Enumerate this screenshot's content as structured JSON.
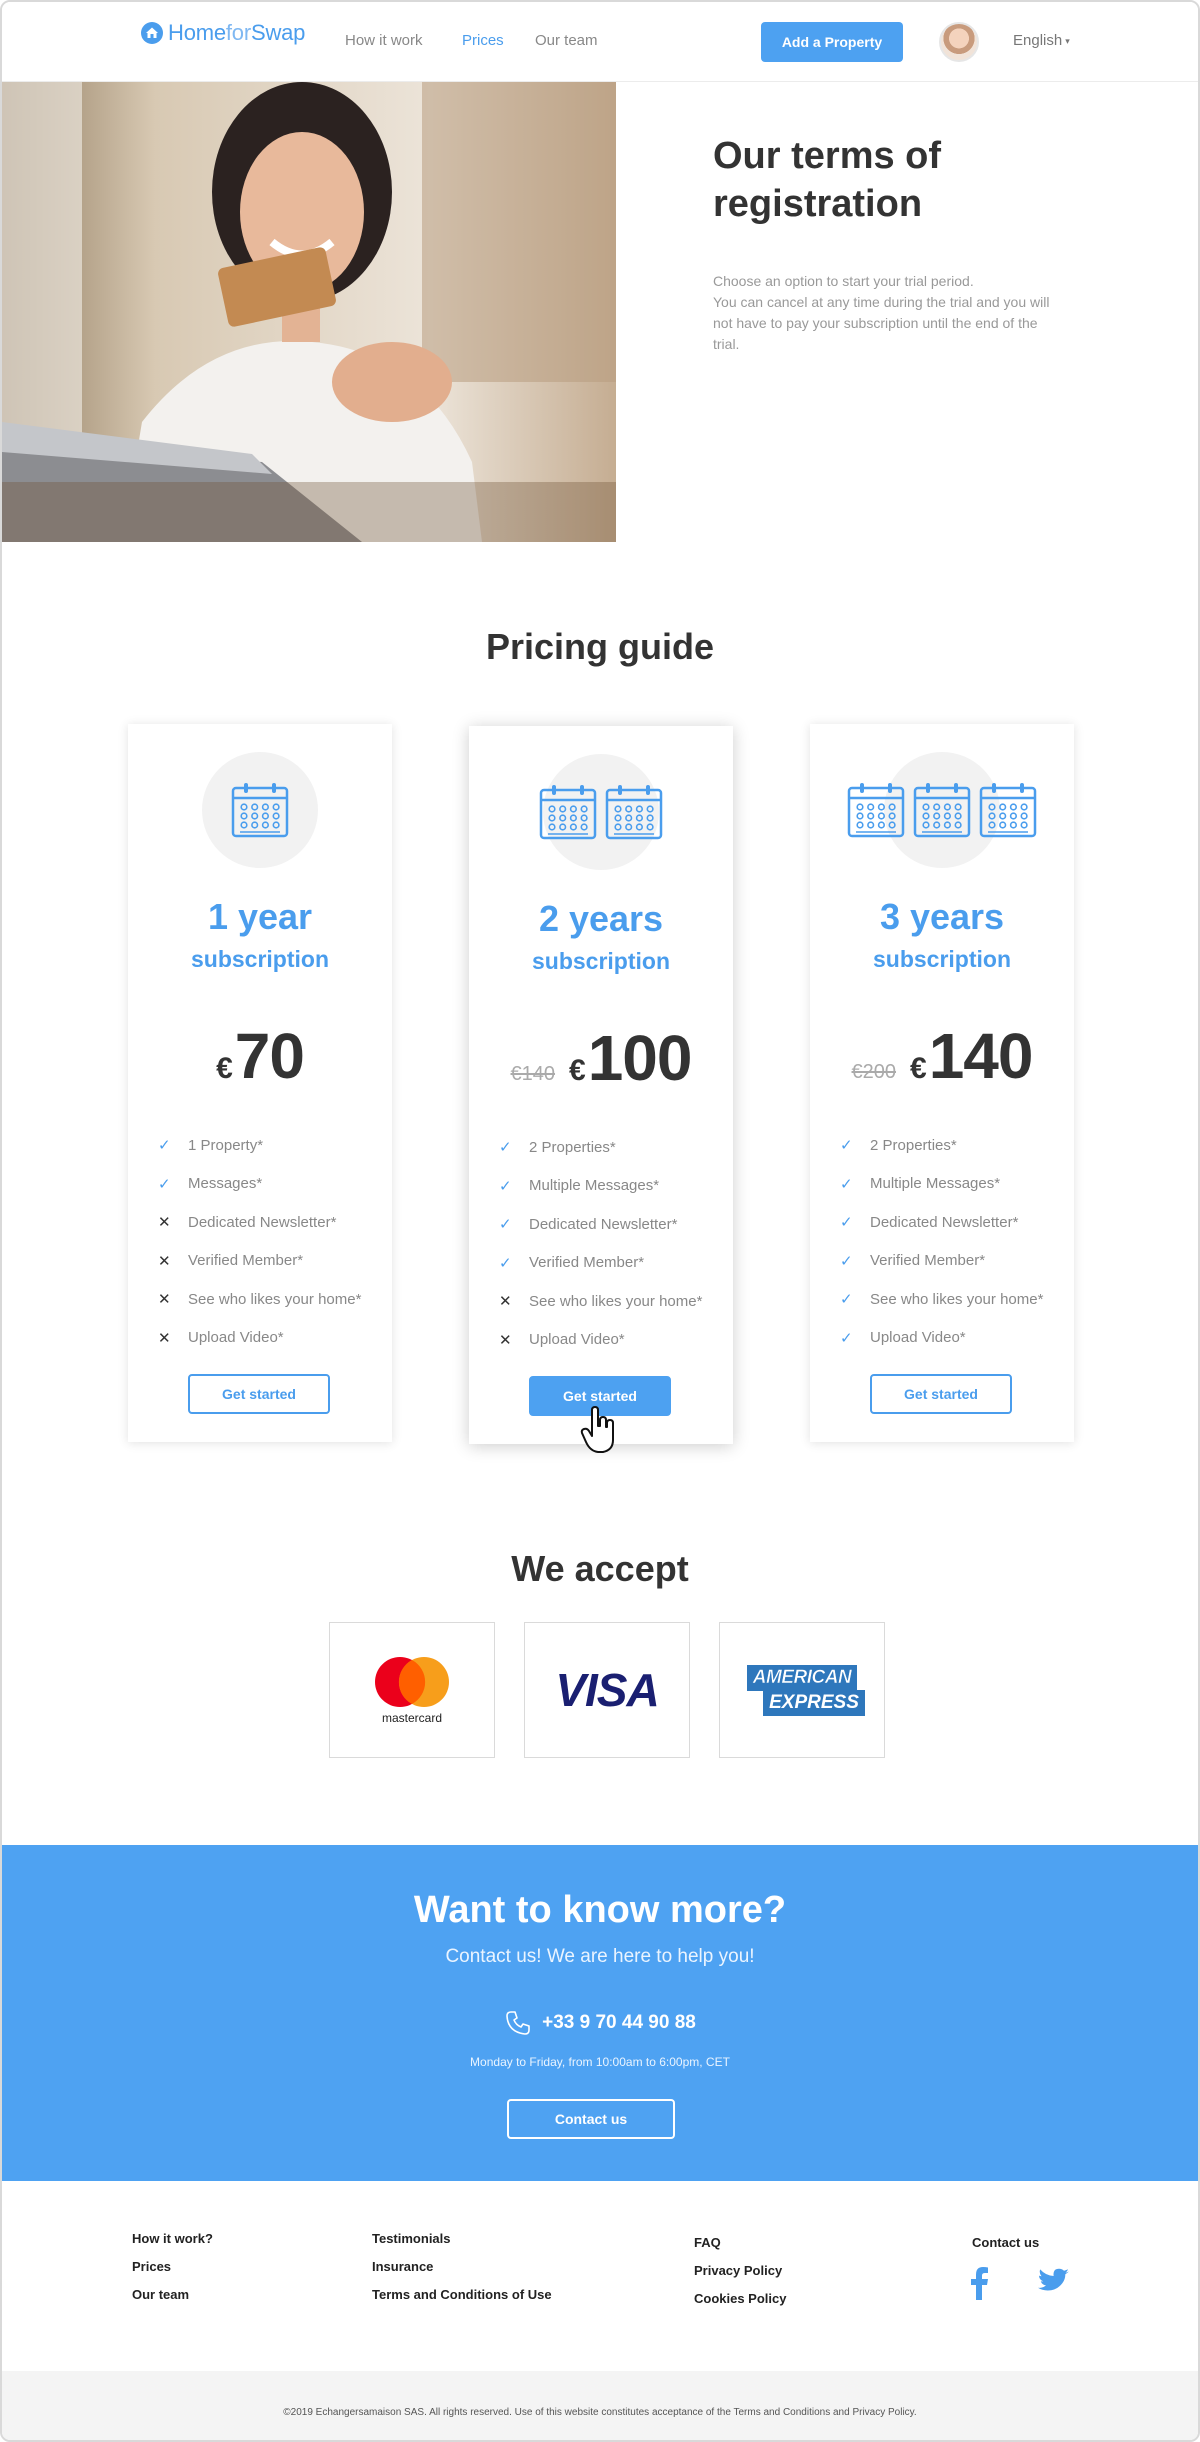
{
  "header": {
    "logo": {
      "home": "Home",
      "for": "for",
      "swap": "Swap"
    },
    "nav": [
      {
        "label": "How it work",
        "active": false
      },
      {
        "label": "Prices",
        "active": true
      },
      {
        "label": "Our team",
        "active": false
      }
    ],
    "add_property_label": "Add a Property",
    "language": "English"
  },
  "hero": {
    "title": "Our terms of registration",
    "description_line1": "Choose an option to start your trial period.",
    "description_line2": "You can cancel at any time during the trial and you will not have to pay your subscription until the end of the trial."
  },
  "pricing": {
    "title": "Pricing guide",
    "plans": [
      {
        "number": "1 year",
        "subtitle": "subscription",
        "old_price": "",
        "currency": "€",
        "price": "70",
        "calendars": 1,
        "features": [
          {
            "label": "1 Property*",
            "included": true
          },
          {
            "label": "Messages*",
            "included": true
          },
          {
            "label": "Dedicated Newsletter*",
            "included": false
          },
          {
            "label": "Verified Member*",
            "included": false
          },
          {
            "label": "See who likes your home*",
            "included": false
          },
          {
            "label": "Upload Video*",
            "included": false
          }
        ],
        "button_label": "Get started"
      },
      {
        "number": "2 years",
        "subtitle": "subscription",
        "old_price": "€140",
        "currency": "€",
        "price": "100",
        "calendars": 2,
        "features": [
          {
            "label": "2 Properties*",
            "included": true
          },
          {
            "label": "Multiple Messages*",
            "included": true
          },
          {
            "label": "Dedicated Newsletter*",
            "included": true
          },
          {
            "label": "Verified Member*",
            "included": true
          },
          {
            "label": "See who likes your home*",
            "included": false
          },
          {
            "label": "Upload Video*",
            "included": false
          }
        ],
        "button_label": "Get started"
      },
      {
        "number": "3 years",
        "subtitle": "subscription",
        "old_price": "€200",
        "currency": "€",
        "price": "140",
        "calendars": 3,
        "features": [
          {
            "label": "2 Properties*",
            "included": true
          },
          {
            "label": "Multiple Messages*",
            "included": true
          },
          {
            "label": "Dedicated Newsletter*",
            "included": true
          },
          {
            "label": "Verified Member*",
            "included": true
          },
          {
            "label": "See who likes your home*",
            "included": true
          },
          {
            "label": "Upload Video*",
            "included": true
          }
        ],
        "button_label": "Get started"
      }
    ]
  },
  "payment": {
    "title": "We accept",
    "mastercard_label": "mastercard",
    "visa_label": "VISA",
    "amex_line1": "AMERICAN",
    "amex_line2": "EXPRESS"
  },
  "contact": {
    "title": "Want to know more?",
    "subtitle": "Contact us! We are here to help you!",
    "phone": "+33 9 70 44 90 88",
    "hours": "Monday to Friday, from 10:00am to 6:00pm, CET",
    "button_label": "Contact us"
  },
  "footer": {
    "col1": [
      "How it work?",
      "Prices",
      "Our team"
    ],
    "col2": [
      "Testimonials",
      "Insurance",
      "Terms and Conditions of Use"
    ],
    "col3": [
      "FAQ",
      "Privacy Policy",
      "Cookies Policy"
    ],
    "contact_label": "Contact us",
    "copyright": "©2019 Echangersamaison SAS. All rights reserved. Use of this website constitutes acceptance of the Terms and Conditions and Privacy Policy."
  },
  "colors": {
    "accent": "#4a9ded",
    "band": "#4ea2f2",
    "text": "#333333"
  },
  "icons": [
    "home-logo-icon",
    "calendar-icon",
    "check-icon",
    "cross-icon",
    "phone-icon",
    "facebook-icon",
    "twitter-icon",
    "hand-cursor-icon"
  ]
}
